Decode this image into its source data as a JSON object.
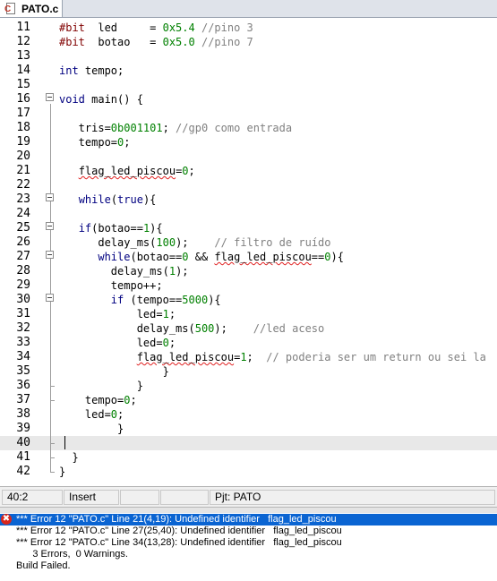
{
  "tab": {
    "label": "PATO.c",
    "icon": "c-source-file-icon"
  },
  "editor": {
    "lines": [
      {
        "n": "11",
        "html": "<span class='pp'>#bit</span>  led     = <span class='num'>0x5.4</span> <span class='cm'>//pino 3</span>"
      },
      {
        "n": "12",
        "html": "<span class='pp'>#bit</span>  botao   = <span class='num'>0x5.0</span> <span class='cm'>//pino 7</span>"
      },
      {
        "n": "13",
        "html": ""
      },
      {
        "n": "14",
        "html": "<span class='kw'>int</span> tempo;"
      },
      {
        "n": "15",
        "html": ""
      },
      {
        "n": "16",
        "html": "<span class='kw'>void</span> main() {"
      },
      {
        "n": "17",
        "html": ""
      },
      {
        "n": "18",
        "html": "   tris=<span class='num'>0b001101</span>; <span class='cm'>//gp0 como entrada</span>"
      },
      {
        "n": "19",
        "html": "   tempo=<span class='num'>0</span>;"
      },
      {
        "n": "20",
        "html": ""
      },
      {
        "n": "21",
        "html": "   <span class='err'>flag_led_piscou</span>=<span class='num'>0</span>;"
      },
      {
        "n": "22",
        "html": ""
      },
      {
        "n": "23",
        "html": "   <span class='kw'>while</span>(<span class='kw'>true</span>){"
      },
      {
        "n": "24",
        "html": ""
      },
      {
        "n": "25",
        "html": "   <span class='kw'>if</span>(botao==<span class='num'>1</span>){"
      },
      {
        "n": "26",
        "html": "      delay_ms(<span class='num'>100</span>);    <span class='cm'>// filtro de ruído</span>"
      },
      {
        "n": "27",
        "html": "      <span class='kw'>while</span>(botao==<span class='num'>0</span> &amp;&amp; <span class='err'>flag_led_piscou</span>==<span class='num'>0</span>){"
      },
      {
        "n": "28",
        "html": "        delay_ms(<span class='num'>1</span>);"
      },
      {
        "n": "29",
        "html": "        tempo++;"
      },
      {
        "n": "30",
        "html": "        <span class='kw'>if</span> (tempo==<span class='num'>5000</span>){"
      },
      {
        "n": "31",
        "html": "            led=<span class='num'>1</span>;"
      },
      {
        "n": "32",
        "html": "            delay_ms(<span class='num'>500</span>);    <span class='cm'>//led aceso</span>"
      },
      {
        "n": "33",
        "html": "            led=<span class='num'>0</span>;"
      },
      {
        "n": "34",
        "html": "            <span class='err'>flag_led_piscou</span>=<span class='num'>1</span>;  <span class='cm'>// poderia ser um return ou sei la</span>"
      },
      {
        "n": "35",
        "html": "                }"
      },
      {
        "n": "36",
        "html": "            }"
      },
      {
        "n": "37",
        "html": "    tempo=<span class='num'>0</span>;"
      },
      {
        "n": "38",
        "html": "    led=<span class='num'>0</span>;"
      },
      {
        "n": "39",
        "html": "         }"
      },
      {
        "n": "40",
        "html": ""
      },
      {
        "n": "41",
        "html": "  }"
      },
      {
        "n": "42",
        "html": "}"
      }
    ],
    "current_line": "40"
  },
  "status": {
    "position": "40:2",
    "mode": "Insert",
    "blank1": "",
    "blank2": "",
    "project": "Pjt: PATO"
  },
  "output": {
    "rows": [
      {
        "text": "*** Error 12 \"PATO.c\" Line 21(4,19): Undefined identifier   flag_led_piscou",
        "selected": true
      },
      {
        "text": "*** Error 12 \"PATO.c\" Line 27(25,40): Undefined identifier   flag_led_piscou",
        "selected": false
      },
      {
        "text": "*** Error 12 \"PATO.c\" Line 34(13,28): Undefined identifier   flag_led_piscou",
        "selected": false
      },
      {
        "text": "      3 Errors,  0 Warnings.",
        "selected": false
      },
      {
        "text": "Build Failed.",
        "selected": false
      }
    ],
    "icon": "error-icon",
    "icon_glyph": "✖",
    "colors": {
      "selected": "#0a64d2",
      "error": "#d9261c"
    }
  }
}
